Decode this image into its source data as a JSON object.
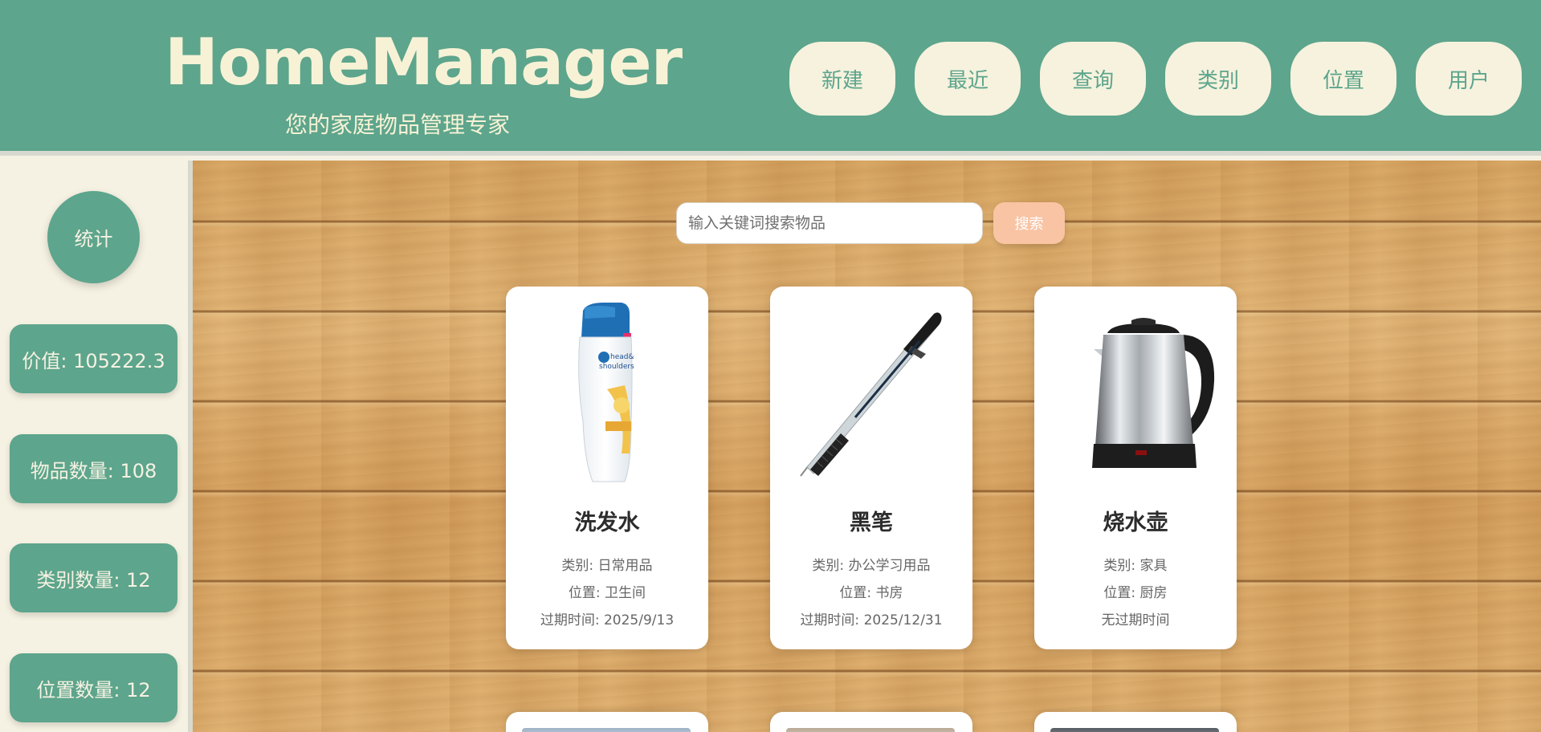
{
  "header": {
    "title": "HomeManager",
    "subtitle": "您的家庭物品管理专家",
    "nav": [
      "新建",
      "最近",
      "查询",
      "类别",
      "位置",
      "用户"
    ]
  },
  "sidebar": {
    "stats_label": "统计",
    "stats": [
      "价值: 105222.3",
      "物品数量: 108",
      "类别数量: 12",
      "位置数量: 12"
    ]
  },
  "search": {
    "placeholder": "输入关键词搜索物品",
    "button": "搜索"
  },
  "items": [
    {
      "name": "洗发水",
      "category": "类别: 日常用品",
      "location": "位置: 卫生间",
      "expiry": "过期时间: 2025/9/13",
      "icon": "shampoo-bottle-image"
    },
    {
      "name": "黑笔",
      "category": "类别: 办公学习用品",
      "location": "位置: 书房",
      "expiry": "过期时间: 2025/12/31",
      "icon": "black-pen-image"
    },
    {
      "name": "烧水壶",
      "category": "类别: 家具",
      "location": "位置: 厨房",
      "expiry": "无过期时间",
      "icon": "kettle-image"
    }
  ],
  "colors": {
    "primary": "#5da58c",
    "cream": "#f6f2de",
    "search_button": "#f9c4a4"
  }
}
